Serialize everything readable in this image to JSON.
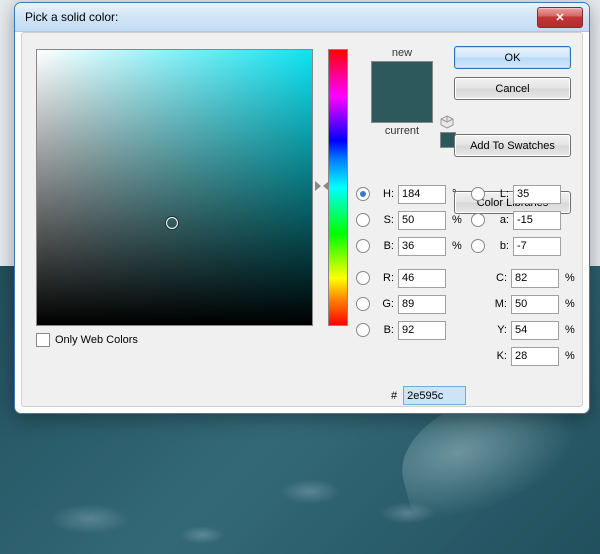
{
  "title": "Pick a solid color:",
  "preview": {
    "new_label": "new",
    "current_label": "current",
    "new_color": "#2e595c",
    "current_color": "#2e595c"
  },
  "buttons": {
    "ok": "OK",
    "cancel": "Cancel",
    "add_swatches": "Add To Swatches",
    "color_libs": "Color Libraries"
  },
  "hsb": {
    "h_label": "H:",
    "s_label": "S:",
    "b_label": "B:",
    "h": "184",
    "s": "50",
    "b": "36",
    "h_unit": "°",
    "pct": "%"
  },
  "rgb": {
    "r_label": "R:",
    "g_label": "G:",
    "b_label": "B:",
    "r": "46",
    "g": "89",
    "b": "92"
  },
  "lab": {
    "l_label": "L:",
    "a_label": "a:",
    "b_label": "b:",
    "l": "35",
    "a": "-15",
    "b": "-7"
  },
  "cmyk": {
    "c_label": "C:",
    "m_label": "M:",
    "y_label": "Y:",
    "k_label": "K:",
    "c": "82",
    "m": "50",
    "y": "54",
    "k": "28",
    "pct": "%"
  },
  "hex": {
    "label": "#",
    "value": "2e595c"
  },
  "only_web": "Only Web Colors"
}
